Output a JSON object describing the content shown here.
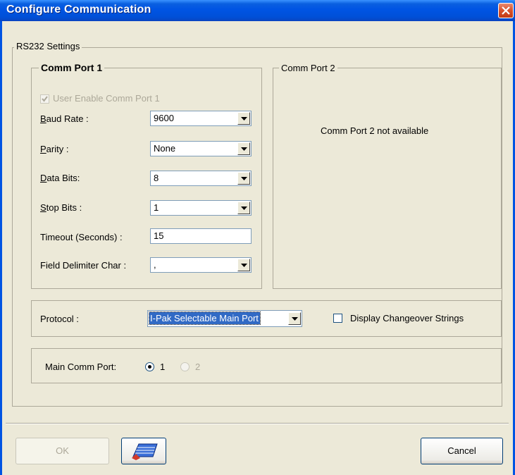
{
  "window": {
    "title": "Configure Communication"
  },
  "rs232": {
    "legend": "RS232 Settings",
    "port1": {
      "legend": "Comm Port 1",
      "enable_label": "User Enable Comm Port 1",
      "baud": {
        "label_key": "B",
        "label_rest": "aud Rate :",
        "value": "9600"
      },
      "parity": {
        "label_key": "P",
        "label_rest": "arity :",
        "value": "None"
      },
      "databits": {
        "label_key": "D",
        "label_rest": "ata Bits:",
        "value": "8"
      },
      "stopbits": {
        "label_key": "S",
        "label_rest": "top Bits :",
        "value": "1"
      },
      "timeout": {
        "label": "Timeout (Seconds) :",
        "value": "15"
      },
      "delimiter": {
        "label": "Field Delimiter Char :",
        "value": ","
      }
    },
    "port2": {
      "legend": "Comm Port 2",
      "message": "Comm Port 2 not available"
    }
  },
  "protocol": {
    "label": "Protocol :",
    "value": "I-Pak Selectable Main Port",
    "changeover_label": "Display Changeover Strings"
  },
  "main_port": {
    "label": "Main Comm Port:",
    "option1": "1",
    "option2": "2"
  },
  "buttons": {
    "ok": "OK",
    "cancel": "Cancel"
  },
  "colors": {
    "titlebar": "#0054e3",
    "face": "#ECE9D8",
    "close": "#d8512b"
  }
}
